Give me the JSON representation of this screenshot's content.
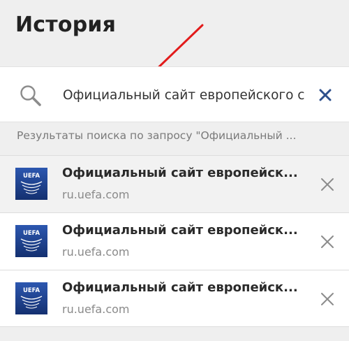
{
  "header": {
    "title": "История"
  },
  "search": {
    "value": "Официальный сайт европейского с",
    "icon": "search-icon",
    "clear_icon": "clear-icon"
  },
  "results": {
    "caption": "Результаты поиска по запросу \"Официальный ..."
  },
  "items": [
    {
      "title": "Официальный сайт европейск...",
      "url": "ru.uefa.com",
      "logo": "uefa-logo",
      "logo_text": "UEFA",
      "remove_icon": "remove-icon"
    },
    {
      "title": "Официальный сайт европейск...",
      "url": "ru.uefa.com",
      "logo": "uefa-logo",
      "logo_text": "UEFA",
      "remove_icon": "remove-icon"
    },
    {
      "title": "Официальный сайт европейск...",
      "url": "ru.uefa.com",
      "logo": "uefa-logo",
      "logo_text": "UEFA",
      "remove_icon": "remove-icon"
    }
  ],
  "colors": {
    "annotation_arrow": "#e21b1b",
    "clear_icon": "#2d4f8b",
    "logo_background": "#1c3d8c"
  }
}
